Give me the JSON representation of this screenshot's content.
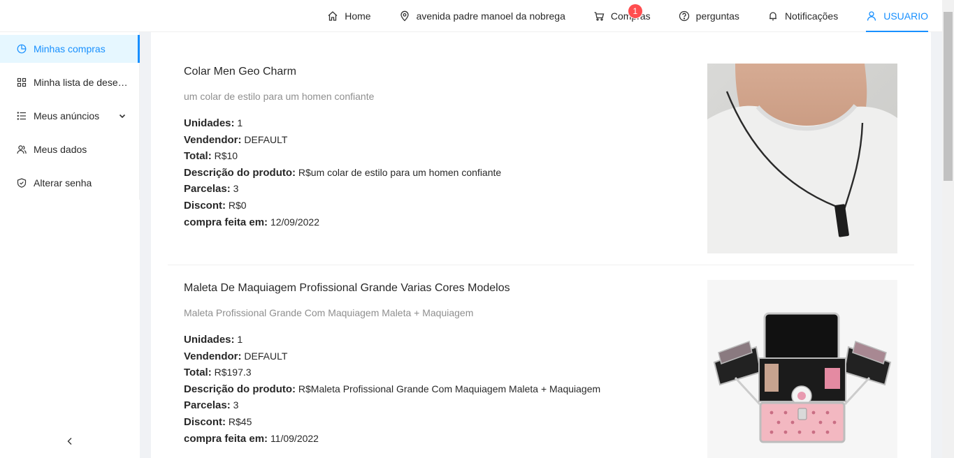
{
  "header": {
    "nav": [
      {
        "label": "Home",
        "icon": "home-icon"
      },
      {
        "label": "avenida padre manoel da nobrega",
        "icon": "location-pin-icon"
      },
      {
        "label": "Compras",
        "icon": "cart-icon",
        "badge": "1"
      },
      {
        "label": "perguntas",
        "icon": "question-circle-icon"
      },
      {
        "label": "Notificações",
        "icon": "bell-icon"
      },
      {
        "label": "USUARIO",
        "icon": "user-icon"
      }
    ]
  },
  "sidebar": {
    "items": [
      {
        "label": "Minhas compras",
        "icon": "pie-chart-icon"
      },
      {
        "label": "Minha lista de desejos",
        "icon": "grid-icon"
      },
      {
        "label": "Meus anúncios",
        "icon": "ordered-list-icon"
      },
      {
        "label": "Meus dados",
        "icon": "team-icon"
      },
      {
        "label": "Alterar senha",
        "icon": "shield-check-icon"
      }
    ],
    "collapse_icon": "chevron-left-icon"
  },
  "field_labels": {
    "units": "Unidades:",
    "seller": "Vendendor:",
    "total": "Total:",
    "description": "Descrição do produto:",
    "installments": "Parcelas:",
    "discount": "Discont:",
    "purchased_at": "compra feita em:"
  },
  "purchases": [
    {
      "title": "Colar Men Geo Charm",
      "subtitle": "um colar de estilo para um homen confiante",
      "units": "1",
      "seller": "DEFAULT",
      "total": "R$10",
      "description": "R$um colar de estilo para um homen confiante",
      "installments": "3",
      "discount": "R$0",
      "purchased_at": "12/09/2022"
    },
    {
      "title": "Maleta De Maquiagem Profissional Grande Varias Cores Modelos",
      "subtitle": "Maleta Profissional Grande Com Maquiagem Maleta + Maquiagem",
      "units": "1",
      "seller": "DEFAULT",
      "total": "R$197.3",
      "description": "R$Maleta Profissional Grande Com Maquiagem Maleta + Maquiagem",
      "installments": "3",
      "discount": "R$45",
      "purchased_at": "11/09/2022"
    }
  ],
  "colors": {
    "accent": "#1890ff",
    "badge": "#ff4d4f",
    "selected_bg": "#e6f7ff"
  }
}
